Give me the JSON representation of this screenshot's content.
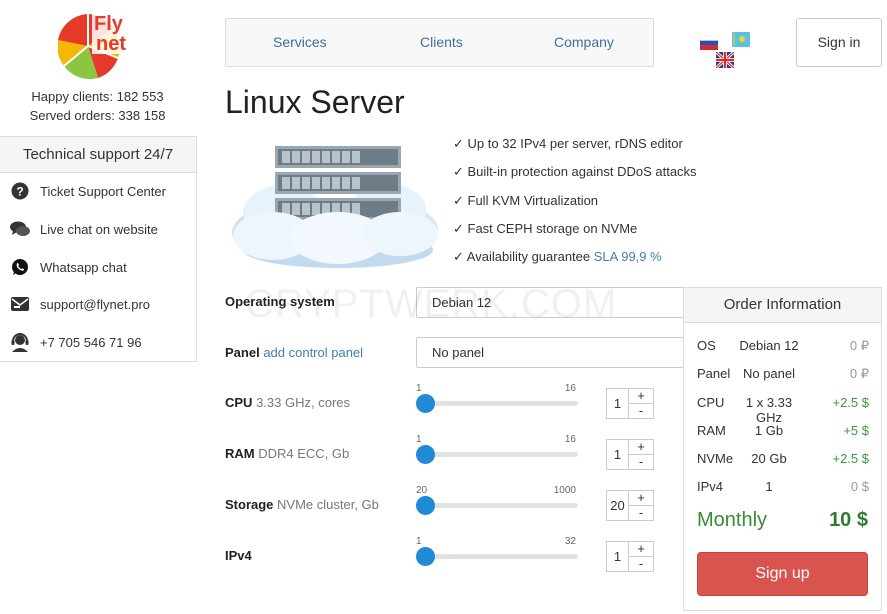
{
  "brand": {
    "name_line1": "Fly",
    "name_line2": "net"
  },
  "stats": {
    "happy_clients": "Happy clients: 182 553",
    "served_orders": "Served orders: 338 158"
  },
  "support": {
    "title": "Technical support 24/7",
    "items": [
      {
        "icon": "question-circle-icon",
        "label": "Ticket Support Center"
      },
      {
        "icon": "chat-bubbles-icon",
        "label": "Live chat on website"
      },
      {
        "icon": "whatsapp-icon",
        "label": "Whatsapp chat"
      },
      {
        "icon": "envelope-icon",
        "label": "support@flynet.pro"
      },
      {
        "icon": "headset-icon",
        "label": "+7 705 546 71 96"
      }
    ]
  },
  "nav": {
    "items": [
      "Services",
      "Clients",
      "Company"
    ]
  },
  "header": {
    "sign_in": "Sign in"
  },
  "page": {
    "title": "Linux Server"
  },
  "features": [
    "✓ Up to 32 IPv4 per server, rDNS editor",
    "✓ Built-in protection against DDoS attacks",
    "✓ Full KVM Virtualization",
    "✓ Fast CEPH storage on NVMe",
    "✓ Availability guarantee "
  ],
  "sla": "SLA 99,9 %",
  "form": {
    "os": {
      "label": "Operating system",
      "value": "Debian 12"
    },
    "panel": {
      "label": "Panel",
      "link": "add control panel",
      "value": "No panel"
    },
    "cpu": {
      "label": "CPU",
      "sub": "3.33 GHz, cores",
      "min": "1",
      "max": "16",
      "value": "1",
      "fraction": 0
    },
    "ram": {
      "label": "RAM",
      "sub": "DDR4 ECC, Gb",
      "min": "1",
      "max": "16",
      "value": "1",
      "fraction": 0
    },
    "storage": {
      "label": "Storage",
      "sub": "NVMe cluster, Gb",
      "min": "20",
      "max": "1000",
      "value": "20",
      "fraction": 0
    },
    "ipv4": {
      "label": "IPv4",
      "min": "1",
      "max": "32",
      "value": "1",
      "fraction": 0
    },
    "plus": "+",
    "minus": "-"
  },
  "order": {
    "title": "Order Information",
    "rows": [
      {
        "key": "OS",
        "value": "Debian 12",
        "price": "0 ₽"
      },
      {
        "key": "Panel",
        "value": "No panel",
        "price": "0 ₽"
      },
      {
        "key": "CPU",
        "value": "1 x 3.33 GHz",
        "price": "+2.5 $"
      },
      {
        "key": "RAM",
        "value": "1 Gb",
        "price": "+5 $"
      },
      {
        "key": "NVMe",
        "value": "20 Gb",
        "price": "+2.5 $"
      },
      {
        "key": "IPv4",
        "value": "1",
        "price": "0 $"
      }
    ],
    "monthly_label": "Monthly",
    "monthly_value": "10 $",
    "signup": "Sign up"
  },
  "watermark": "CRYPTWERK.COM",
  "colors": {
    "accent": "#3f7fae",
    "slider": "#1f8ad6",
    "signup": "#d9534f",
    "price_green": "#3a9a3a"
  }
}
